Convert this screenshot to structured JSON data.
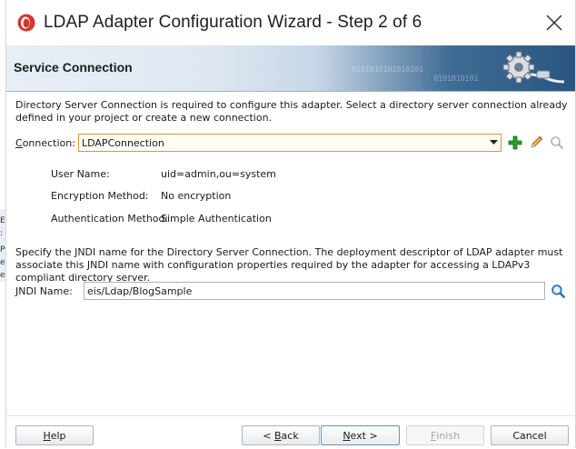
{
  "window": {
    "title": "LDAP Adapter Configuration Wizard - Step 2 of 6"
  },
  "banner": {
    "title": "Service Connection",
    "binary_text_1": "0101010101010101",
    "binary_text_2": "0101010101"
  },
  "content": {
    "description": "Directory Server Connection is required to configure this adapter. Select a directory server connection already defined in your project or create a new connection.",
    "connection": {
      "label_mnemonic": "C",
      "label_rest": "onnection:",
      "value": "LDAPConnection"
    },
    "details": [
      {
        "label": "User Name:",
        "value": "uid=admin,ou=system"
      },
      {
        "label": "Encryption Method:",
        "value": "No encryption"
      },
      {
        "label": "Authentication Method:",
        "value": "Simple Authentication"
      }
    ],
    "jndi_description": "Specify the JNDI name for the Directory Server Connection. The deployment descriptor of LDAP adapter must associate this JNDI name with configuration properties required by the adapter for accessing a LDAPv3 compliant directory server.",
    "jndi": {
      "label_mnemonic": "J",
      "label_rest": "NDI Name:",
      "value": "eis/Ldap/BlogSample"
    }
  },
  "buttons": {
    "help_mnemonic": "H",
    "help_rest": "elp",
    "back_prefix": "< ",
    "back_mnemonic": "B",
    "back_rest": "ack",
    "next_mnemonic": "N",
    "next_rest": "ext >",
    "finish_mnemonic": "F",
    "finish_rest": "inish",
    "cancel": "Cancel"
  },
  "background_window": {
    "fragments": [
      "EX",
      "P",
      "e",
      "e",
      ":"
    ]
  },
  "colors": {
    "accent": "#d39a33",
    "banner_dark": "#2a5580",
    "add_icon": "#2e9a2e"
  }
}
